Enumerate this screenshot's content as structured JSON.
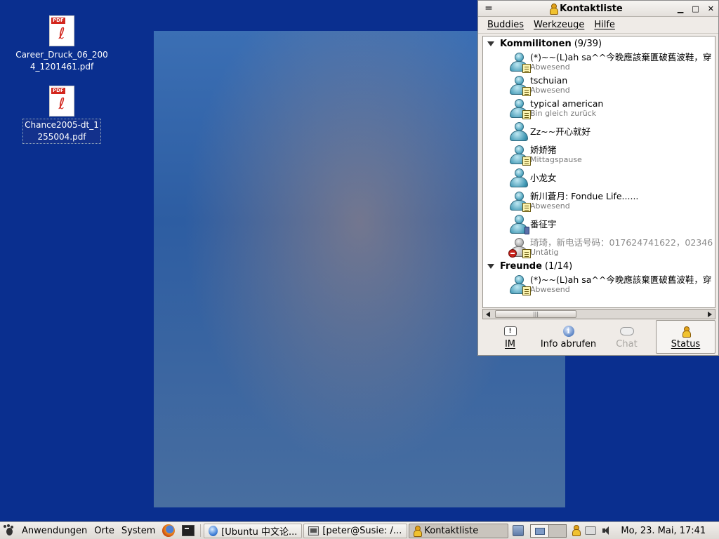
{
  "desktop": {
    "icons": [
      {
        "label": "Career_Druck_06_2004_1201461.pdf",
        "type_tag": "PDF"
      },
      {
        "label": "Chance2005-dt_1255004.pdf",
        "type_tag": "PDF"
      }
    ]
  },
  "buddy_window": {
    "title": "Kontaktliste",
    "menu_glyph": "=",
    "controls": {
      "minimize": "▁",
      "maximize": "□",
      "close": "✕"
    },
    "menu": [
      "Buddies",
      "Werkzeuge",
      "Hilfe"
    ],
    "groups": [
      {
        "name": "Kommilitonen",
        "count": "(9/39)",
        "buddies": [
          {
            "name": "(*)~~(L)ah sa^^今晚應該棄匱破舊波鞋，穿",
            "status": "Abwesend",
            "icon": "away"
          },
          {
            "name": "tschuian",
            "status": "Abwesend",
            "icon": "away"
          },
          {
            "name": "typical american",
            "status": "Bin gleich zurück",
            "icon": "away"
          },
          {
            "name": "Zz~~开心就好",
            "status": "",
            "icon": "online"
          },
          {
            "name": "娇娇猪",
            "status": "Mittagspause",
            "icon": "away"
          },
          {
            "name": "小龙女",
            "status": "",
            "icon": "online"
          },
          {
            "name": "新川蒼月: Fondue Life......",
            "status": "Abwesend",
            "icon": "away"
          },
          {
            "name": "番征宇",
            "status": "",
            "icon": "mobile"
          },
          {
            "name": "琦琦，新电话号码：017624741622，02346",
            "status": "Untätig",
            "icon": "idle"
          }
        ]
      },
      {
        "name": "Freunde",
        "count": "(1/14)",
        "buddies": [
          {
            "name": "(*)~~(L)ah sa^^今晚應該棄匱破舊波鞋，穿",
            "status": "Abwesend",
            "icon": "away"
          }
        ]
      }
    ],
    "scroll_grip": "|||",
    "actions": [
      {
        "label": "IM",
        "icon": "im-icon",
        "enabled": true,
        "pressed": false
      },
      {
        "label": "Info abrufen",
        "icon": "info-icon",
        "enabled": true,
        "pressed": false
      },
      {
        "label": "Chat",
        "icon": "chat-icon",
        "enabled": false,
        "pressed": false
      },
      {
        "label": "Status",
        "icon": "status-icon",
        "enabled": true,
        "pressed": true
      }
    ]
  },
  "taskbar": {
    "menus": [
      "Anwendungen",
      "Orte",
      "System"
    ],
    "tasks": [
      {
        "label": "[Ubuntu 中文论..."
      },
      {
        "label": "[peter@Susie: /..."
      },
      {
        "label": "Kontaktliste"
      }
    ],
    "clock": "Mo, 23. Mai, 17:41"
  }
}
